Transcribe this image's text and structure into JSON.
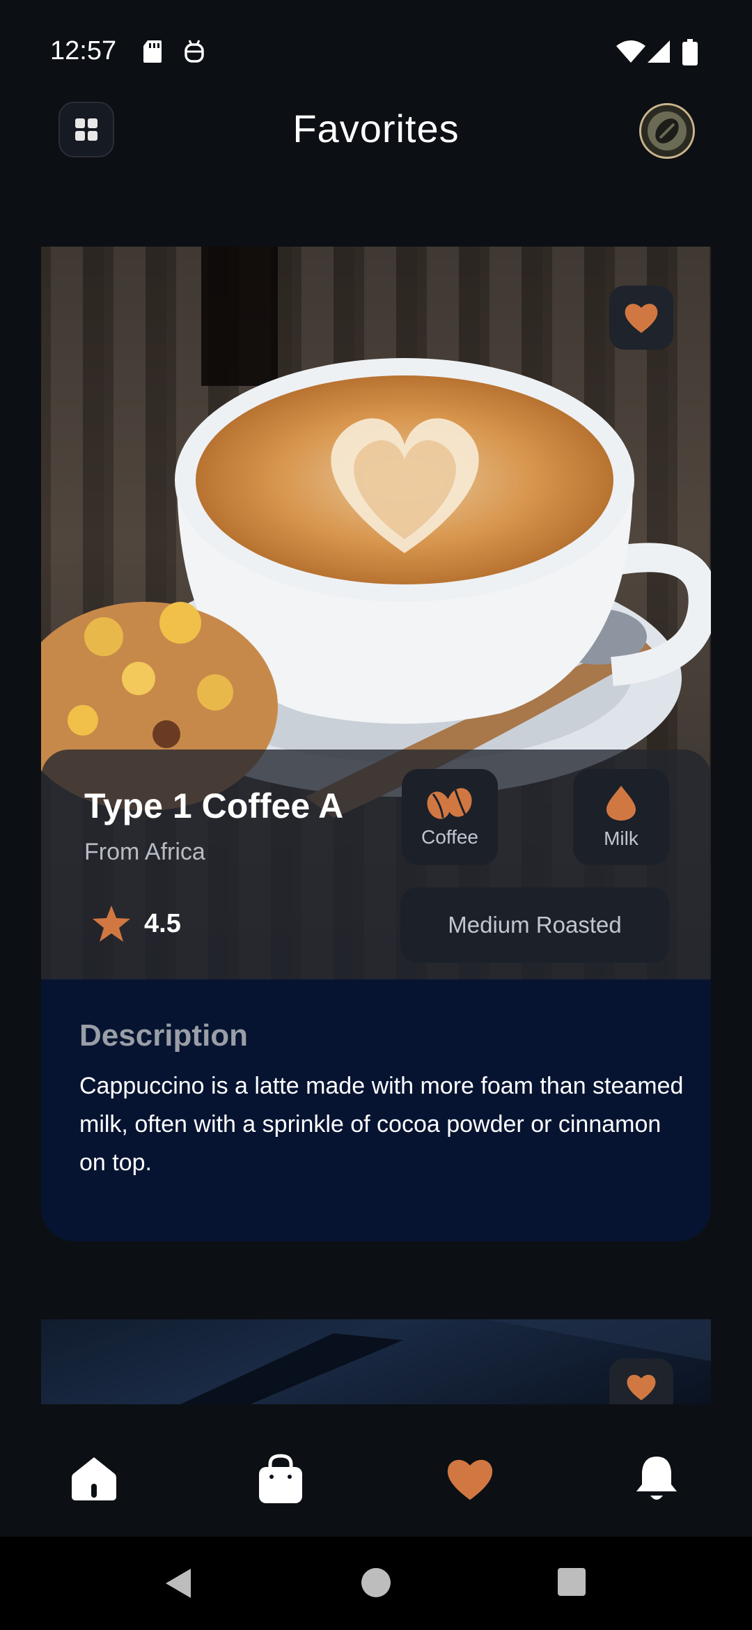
{
  "status_bar": {
    "time": "12:57",
    "icons": [
      "sd-card-icon",
      "debug-icon",
      "wifi-icon",
      "signal-icon",
      "battery-icon"
    ]
  },
  "header": {
    "title": "Favorites",
    "menu_icon": "grid-icon",
    "profile_icon": "coffee-bean-avatar-icon"
  },
  "favorites": [
    {
      "name": "Type 1 Coffee A",
      "origin": "From Africa",
      "rating": "4.5",
      "ingredients": [
        {
          "label": "Coffee",
          "icon": "coffee-beans-icon"
        },
        {
          "label": "Milk",
          "icon": "milk-drop-icon"
        }
      ],
      "roast": "Medium Roasted",
      "favorited": true,
      "description_heading": "Description",
      "description": "Cappuccino is a latte made with more foam than steamed milk, often with a sprinkle of cocoa powder or cinnamon on top."
    }
  ],
  "bottom_nav": {
    "items": [
      {
        "name": "home",
        "icon": "home-icon",
        "active": false
      },
      {
        "name": "cart",
        "icon": "shopping-bag-icon",
        "active": false
      },
      {
        "name": "favorites",
        "icon": "heart-icon",
        "active": true
      },
      {
        "name": "notifications",
        "icon": "bell-icon",
        "active": false
      }
    ]
  },
  "colors": {
    "background": "#0c0f14",
    "accent": "#d17842",
    "card_description_bg": "#071431",
    "tag_bg": "#1c2029"
  }
}
